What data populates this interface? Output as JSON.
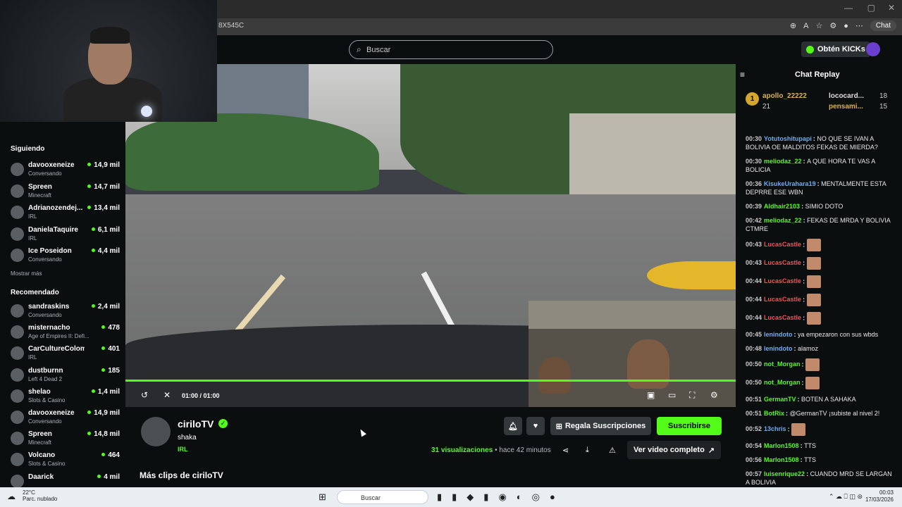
{
  "browser": {
    "url": "8X545C",
    "chat_label": "Chat"
  },
  "header": {
    "search_placeholder": "Buscar",
    "kicks_label": "Obtén KICKs"
  },
  "sidebar": {
    "following_title": "Siguiendo",
    "following": [
      {
        "name": "davooxeneize",
        "game": "Conversando",
        "viewers": "14,9 mil"
      },
      {
        "name": "Spreen",
        "game": "Minecraft",
        "viewers": "14,7 mil"
      },
      {
        "name": "Adrianozendej...",
        "game": "IRL",
        "viewers": "13,4 mil"
      },
      {
        "name": "DanielaTaquire",
        "game": "IRL",
        "viewers": "6,1 mil"
      },
      {
        "name": "Ice Poseidon",
        "game": "Conversando",
        "viewers": "4,4 mil"
      }
    ],
    "show_more": "Mostrar más",
    "recommended_title": "Recomendado",
    "recommended": [
      {
        "name": "sandraskins",
        "game": "Conversando",
        "viewers": "2,4 mil"
      },
      {
        "name": "misternacho",
        "game": "Age of Empires II: Defi...",
        "viewers": "478"
      },
      {
        "name": "CarCultureColombia",
        "game": "IRL",
        "viewers": "401"
      },
      {
        "name": "dustburnn",
        "game": "Left 4 Dead 2",
        "viewers": "185"
      },
      {
        "name": "shelao",
        "game": "Slots & Casino",
        "viewers": "1,4 mil"
      },
      {
        "name": "davooxeneize",
        "game": "Conversando",
        "viewers": "14,9 mil"
      },
      {
        "name": "Spreen",
        "game": "Minecraft",
        "viewers": "14,8 mil"
      },
      {
        "name": "Volcano",
        "game": "Slots & Casino",
        "viewers": "464"
      },
      {
        "name": "Daarick",
        "game": "",
        "viewers": "4 mil"
      }
    ]
  },
  "player": {
    "time": "01:00 / 01:00",
    "progress": 1.0
  },
  "video": {
    "channel": "ciriloTV",
    "title": "shaka",
    "category": "IRL",
    "gift_label": "Regala Suscripciones",
    "subscribe_label": "Suscribirse",
    "views_count": "31",
    "views_label": "visualizaciones",
    "ago": "• hace 42 minutos",
    "full_video_label": "Ver video completo",
    "more_clips": "Más clips de ciriloTV"
  },
  "chat": {
    "title": "Chat Replay",
    "leaders": [
      {
        "rank": "1",
        "name": "apollo_22222",
        "count": "21"
      },
      {
        "name": "lococard...",
        "count": "18"
      },
      {
        "name": "pensami...",
        "count": "15"
      }
    ],
    "messages": [
      {
        "t": "00:30",
        "u": "Yotutoshitupapi",
        "c": "#6fa8ff",
        "m": "NO QUE SE IVAN A BOLIVIA OE MALDITOS FEKAS DE MIERDA?"
      },
      {
        "t": "00:30",
        "u": "meliodaz_22",
        "c": "#53fc18",
        "m": "A QUE HORA TE VAS A BOLICIA"
      },
      {
        "t": "00:36",
        "u": "KisukeUrahara19",
        "c": "#6fa8ff",
        "m": "MENTALMENTE ESTA DEPRRE ESE WBN"
      },
      {
        "t": "00:39",
        "u": "Aldhair2103",
        "c": "#53fc18",
        "m": "SIMIO DOTO"
      },
      {
        "t": "00:42",
        "u": "meliodaz_22",
        "c": "#53fc18",
        "m": "FEKAS DE MRDA Y BOLIVIA CTMRE"
      },
      {
        "t": "00:43",
        "u": "LucasCastle",
        "c": "#ff4d4d",
        "m": "",
        "emote": true
      },
      {
        "t": "00:43",
        "u": "LucasCastle",
        "c": "#ff4d4d",
        "m": "",
        "emote": true
      },
      {
        "t": "00:44",
        "u": "LucasCastle",
        "c": "#ff4d4d",
        "m": "",
        "emote": true
      },
      {
        "t": "00:44",
        "u": "LucasCastle",
        "c": "#ff4d4d",
        "m": "",
        "emote": true
      },
      {
        "t": "00:44",
        "u": "LucasCastle",
        "c": "#ff4d4d",
        "m": "",
        "emote": true
      },
      {
        "t": "00:45",
        "u": "lenindoto",
        "c": "#6fa8ff",
        "m": "ya empezaron con sus wbds"
      },
      {
        "t": "00:48",
        "u": "lenindoto",
        "c": "#6fa8ff",
        "m": "alamoz"
      },
      {
        "t": "00:50",
        "u": "not_Morgan",
        "c": "#53fc18",
        "m": "",
        "emote": true
      },
      {
        "t": "00:50",
        "u": "not_Morgan",
        "c": "#53fc18",
        "m": "",
        "emote": true
      },
      {
        "t": "00:51",
        "u": "GermanTV",
        "c": "#53fc18",
        "m": "BOTEN A SAHAKA"
      },
      {
        "t": "00:51",
        "u": "BotRix",
        "c": "#53fc18",
        "m": "@GermanTV ¡subiste al nivel 2!"
      },
      {
        "t": "00:52",
        "u": "13chris",
        "c": "#6fa8ff",
        "m": "",
        "emote": true
      },
      {
        "t": "00:54",
        "u": "Marlon1508",
        "c": "#53fc18",
        "m": "TTS"
      },
      {
        "t": "00:56",
        "u": "Marlon1508",
        "c": "#53fc18",
        "m": "TTS"
      },
      {
        "t": "00:57",
        "u": "luisenrique22",
        "c": "#53fc18",
        "m": "CUANDO MRD SE LARGAN A BOLIVIA"
      }
    ]
  },
  "taskbar": {
    "temp": "22°C",
    "weather": "Parc. nublado",
    "search": "Buscar",
    "time": "00:03",
    "date": "17/03/2026"
  }
}
